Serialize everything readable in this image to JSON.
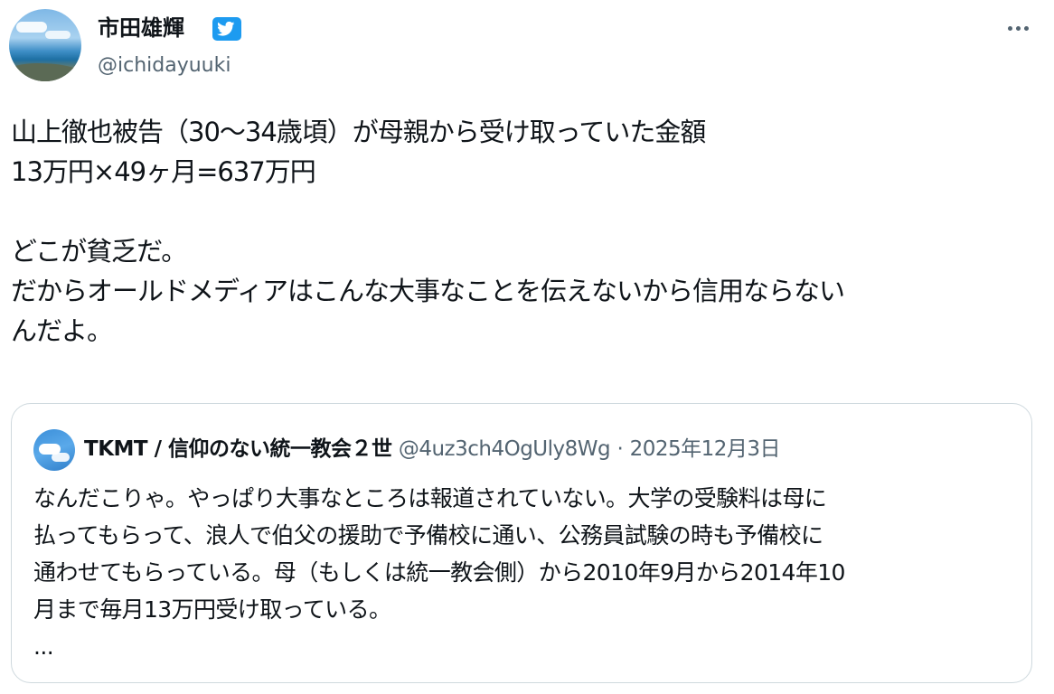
{
  "author": {
    "display_name": "市田雄輝",
    "handle": "@ichidayuuki",
    "verified": true,
    "verified_color": "#1d9bf0"
  },
  "more_button": {
    "icon": "more-horizontal-icon"
  },
  "tweet": {
    "lines": [
      "山上徹也被告（30〜34歳頃）が母親から受け取っていた金額",
      "13万円×49ヶ月=637万円",
      "",
      "どこが貧乏だ。",
      "だからオールドメディアはこんな大事なことを伝えないから信用ならない",
      "んだよ。"
    ]
  },
  "quote": {
    "display_name": "TKMT / 信仰のない統一教会２世",
    "handle": "@4uz3ch4OgUly8Wg",
    "separator": "·",
    "date": "2025年12月3日",
    "lines": [
      "なんだこりゃ。やっぱり大事なところは報道されていない。大学の受験料は母に",
      "払ってもらって、浪人で伯父の援助で予備校に通い、公務員試験の時も予備校に",
      "通わせてもらっている。母（もしくは統一教会側）から2010年9月から2014年10",
      "月まで毎月13万円受け取っている。",
      "..."
    ]
  },
  "colors": {
    "text": "#0f1419",
    "secondary": "#536471",
    "border": "#cfd9de",
    "accent": "#1d9bf0"
  }
}
